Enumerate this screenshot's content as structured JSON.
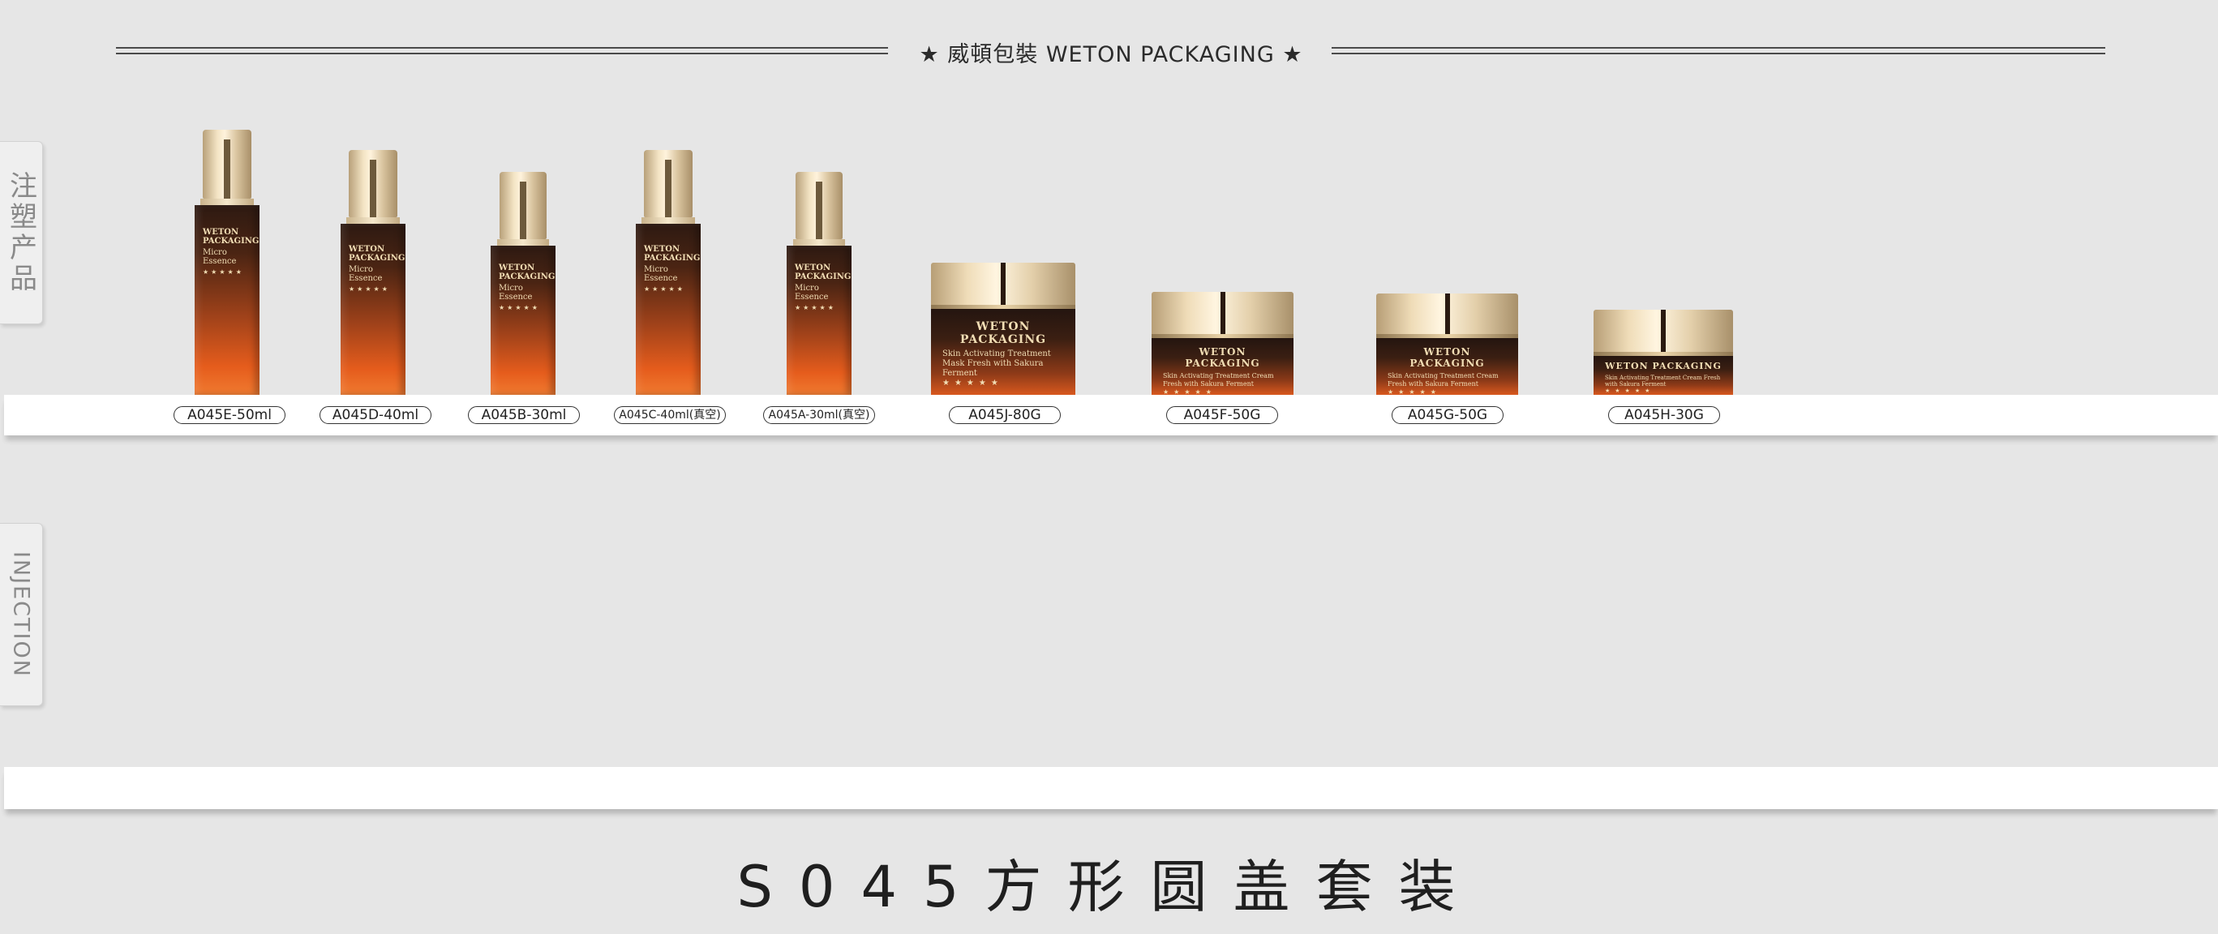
{
  "header": {
    "brand": "★ 威頓包裝 WETON PACKAGING ★"
  },
  "side_tabs": {
    "cn": "注塑产品",
    "en": "INJECTION"
  },
  "bottle_print": {
    "brand": "WETON PACKAGING",
    "product": "Micro Essence",
    "stars": "★★★★★"
  },
  "jar_print": {
    "brand": "WETON PACKAGING",
    "mask_text": "Skin Activating Treatment Mask Fresh with Sakura Ferment",
    "cream_text": "Skin Activating Treatment Cream Fresh with Sakura Ferment",
    "stars": "★★★★★"
  },
  "products": [
    {
      "code": "A045E-50ml"
    },
    {
      "code": "A045D-40ml"
    },
    {
      "code": "A045B-30ml"
    },
    {
      "code": "A045C-40ml(真空)"
    },
    {
      "code": "A045A-30ml(真空)"
    },
    {
      "code": "A045J-80G"
    },
    {
      "code": "A045F-50G"
    },
    {
      "code": "A045G-50G"
    },
    {
      "code": "A045H-30G"
    }
  ],
  "footer": {
    "title": "S045方形圆盖套装"
  }
}
